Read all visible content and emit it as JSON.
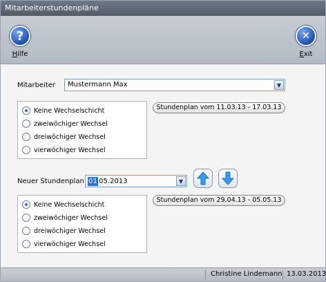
{
  "window": {
    "title": "Mitarbeiterstundenpläne"
  },
  "toolbar": {
    "help": {
      "icon": "question-icon",
      "glyph": "?",
      "label_underlined": "H",
      "label_rest": "ilfe"
    },
    "exit": {
      "icon": "close-icon",
      "glyph": "✕",
      "label_underlined": "E",
      "label_rest": "xit"
    }
  },
  "employee": {
    "label": "Mitarbeiter",
    "value": "Mustermann Max"
  },
  "current_plan": {
    "options": [
      "Keine Wechselschicht",
      "zweiwöchiger Wechsel",
      "dreiwöchiger Wechsel",
      "vierwöchiger Wechsel"
    ],
    "selected_index": 0,
    "plan_button": "Stundenplan vom 11.03.13 - 17.03.13"
  },
  "new_plan": {
    "label": "Neuer Stundenplan ab",
    "date_selected": "01",
    "date_rest": ".05.2013",
    "up_icon": "arrow-up-icon",
    "down_icon": "arrow-down-icon",
    "options": [
      "Keine Wechselschicht",
      "zweiwöchiger Wechsel",
      "dreiwöchiger Wechsel",
      "vierwöchiger Wechsel"
    ],
    "selected_index": 0,
    "plan_button": "Stundenplan vom 29.04.13 - 05.05.13"
  },
  "statusbar": {
    "user": "Christine Lindemann",
    "date": "13.03.2013"
  },
  "colors": {
    "accent": "#2f6fd8",
    "titlebar": "#5f6875"
  }
}
